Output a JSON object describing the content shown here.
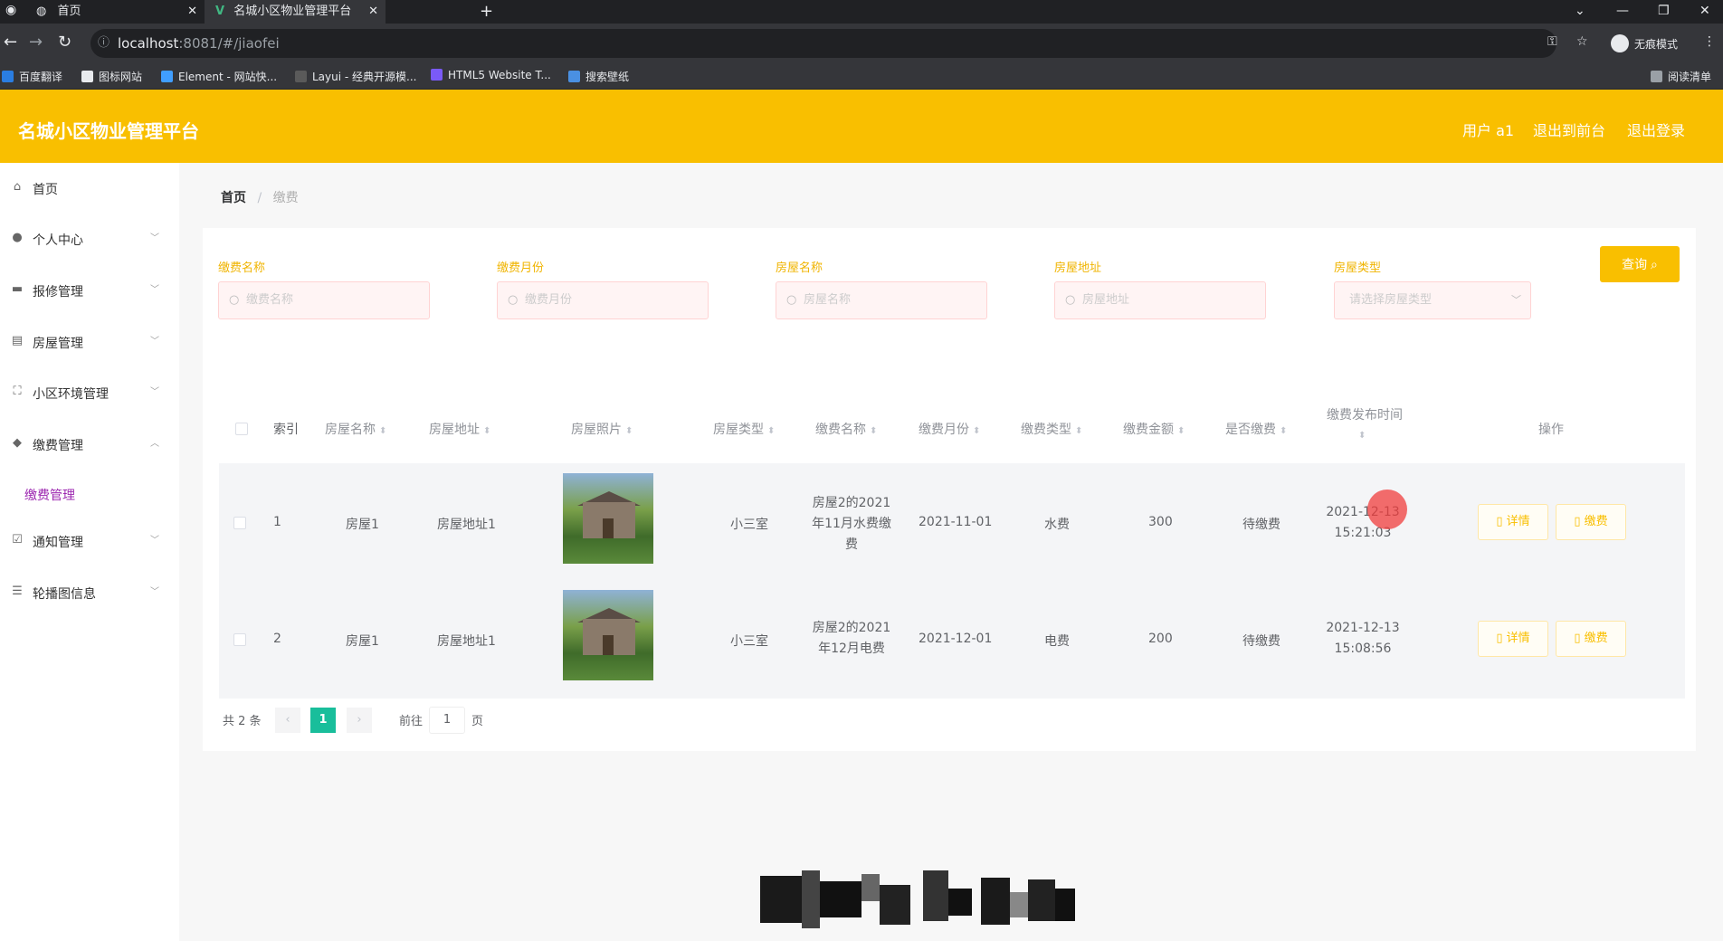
{
  "browser": {
    "tabs": [
      {
        "title": "首页"
      },
      {
        "title": "名城小区物业管理平台"
      }
    ],
    "url_host": "localhost",
    "url_rest": ":8081/#/jiaofei",
    "incognito_label": "无痕模式",
    "bookmarks": [
      "百度翻译",
      "图标网站",
      "Element - 网站快...",
      "Layui - 经典开源模...",
      "HTML5 Website T...",
      "搜索壁纸"
    ],
    "reading_list": "阅读清单"
  },
  "header": {
    "title": "名城小区物业管理平台",
    "user": "用户 a1",
    "to_front": "退出到前台",
    "logout": "退出登录"
  },
  "sidebar": {
    "items": [
      {
        "label": "首页",
        "icon": "home-icon"
      },
      {
        "label": "个人中心",
        "icon": "user-icon"
      },
      {
        "label": "报修管理",
        "icon": "repair-icon"
      },
      {
        "label": "房屋管理",
        "icon": "house-icon"
      },
      {
        "label": "小区环境管理",
        "icon": "environment-icon"
      },
      {
        "label": "缴费管理",
        "icon": "payment-icon"
      }
    ],
    "sub_item": "缴费管理",
    "items2": [
      {
        "label": "通知管理",
        "icon": "notice-icon"
      },
      {
        "label": "轮播图信息",
        "icon": "carousel-icon"
      }
    ]
  },
  "breadcrumb": {
    "home": "首页",
    "sep": "/",
    "current": "缴费"
  },
  "filters": [
    {
      "label": "缴费名称",
      "placeholder": "缴费名称"
    },
    {
      "label": "缴费月份",
      "placeholder": "缴费月份"
    },
    {
      "label": "房屋名称",
      "placeholder": "房屋名称"
    },
    {
      "label": "房屋地址",
      "placeholder": "房屋地址"
    },
    {
      "label": "房屋类型",
      "placeholder": "请选择房屋类型"
    }
  ],
  "query_button": "查询",
  "table": {
    "headers": {
      "index": "索引",
      "house_name": "房屋名称",
      "house_addr": "房屋地址",
      "photo": "房屋照片",
      "house_type": "房屋类型",
      "fee_name": "缴费名称",
      "fee_month": "缴费月份",
      "fee_type": "缴费类型",
      "amount": "缴费金额",
      "paid": "是否缴费",
      "pub_time": "缴费发布时间",
      "ops": "操作"
    },
    "rows": [
      {
        "index": "1",
        "house_name": "房屋1",
        "house_addr": "房屋地址1",
        "house_type": "小三室",
        "fee_name": "房屋2的2021年11月水费缴费",
        "fee_month": "2021-11-01",
        "fee_type": "水费",
        "amount": "300",
        "paid": "待缴费",
        "pub_time": "2021-12-13 15:21:03"
      },
      {
        "index": "2",
        "house_name": "房屋1",
        "house_addr": "房屋地址1",
        "house_type": "小三室",
        "fee_name": "房屋2的2021年12月电费",
        "fee_month": "2021-12-01",
        "fee_type": "电费",
        "amount": "200",
        "paid": "待缴费",
        "pub_time": "2021-12-13 15:08:56"
      }
    ],
    "detail_btn": "详情",
    "pay_btn": "缴费"
  },
  "pagination": {
    "total": "共 2 条",
    "current_page": "1",
    "goto_label": "前往",
    "goto_value": "1",
    "page_suffix": "页"
  },
  "colors": {
    "brand": "#f9bf00",
    "page_active": "#19be9b"
  }
}
